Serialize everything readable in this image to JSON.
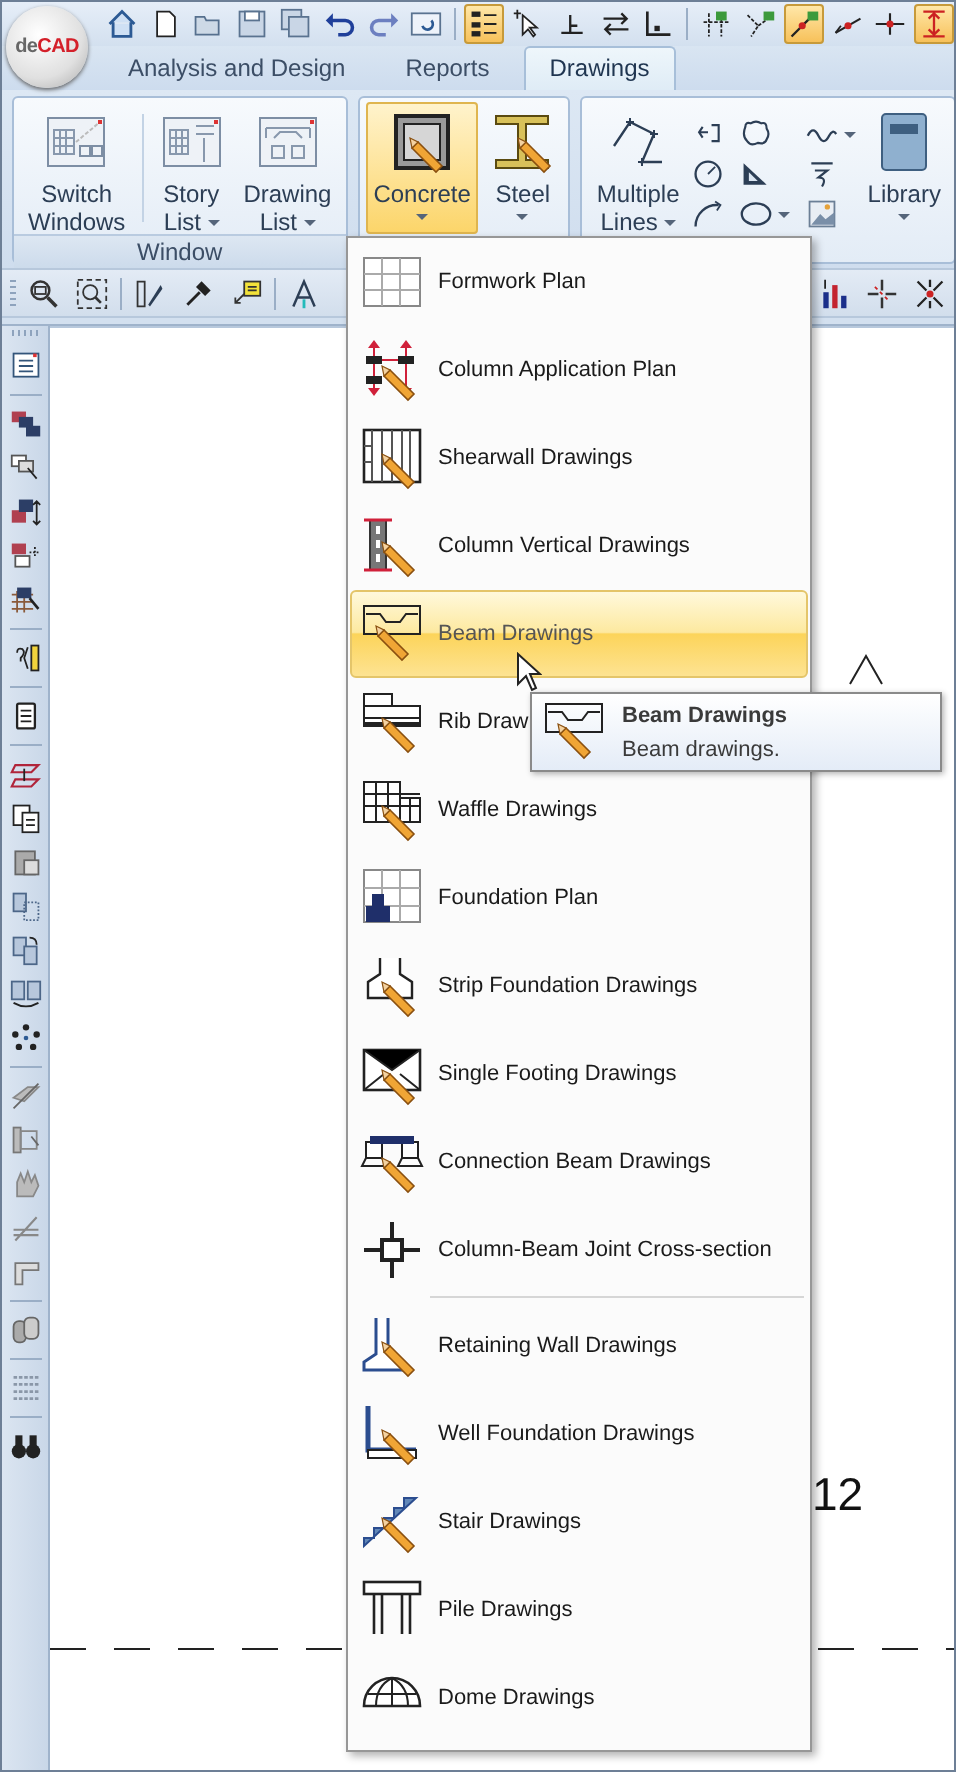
{
  "app": {
    "logo_prefix": "de",
    "logo_name": "CAD"
  },
  "quick_access_toolbar": [
    {
      "on": false
    },
    {
      "on": false
    },
    {
      "on": false
    },
    {
      "on": false
    },
    {
      "on": false
    },
    {
      "on": false
    },
    {
      "on": false
    },
    {
      "on": false
    },
    {
      "on": true
    },
    {
      "on": false
    },
    {
      "on": false
    },
    {
      "on": false
    },
    {
      "on": false
    },
    {
      "on": false
    },
    {
      "on": false
    },
    {
      "on": true
    },
    {
      "on": false
    },
    {
      "on": false
    },
    {
      "on": true
    }
  ],
  "tabs": [
    {
      "label": "Analysis and Design",
      "selected": false
    },
    {
      "label": "Reports",
      "selected": false
    },
    {
      "label": "Drawings",
      "selected": true
    }
  ],
  "ribbon": {
    "groups": [
      {
        "label": "Window",
        "buttons": [
          {
            "label": "Switch Windows",
            "dropdown": false,
            "selected": false
          },
          {
            "label": "Story List",
            "dropdown": true,
            "selected": false
          },
          {
            "label": "Drawing List",
            "dropdown": true,
            "selected": false
          }
        ]
      },
      {
        "buttons": [
          {
            "label": "Concrete",
            "dropdown": true,
            "selected": true
          },
          {
            "label": "Steel",
            "dropdown": true,
            "selected": false
          }
        ]
      },
      {
        "buttons": [
          {
            "label": "Multiple Lines",
            "dropdown": true,
            "selected": false
          },
          {
            "label": "Library",
            "dropdown": true,
            "selected": false
          }
        ]
      }
    ]
  },
  "canvas": {
    "label": "12"
  },
  "dropdown_menu": {
    "items": [
      {
        "label": "Formwork Plan",
        "selected": false,
        "separator_before": false
      },
      {
        "label": "Column Application Plan",
        "selected": false,
        "separator_before": false
      },
      {
        "label": "Shearwall Drawings",
        "selected": false,
        "separator_before": false
      },
      {
        "label": "Column Vertical Drawings",
        "selected": false,
        "separator_before": false
      },
      {
        "label": "Beam Drawings",
        "selected": true,
        "separator_before": false
      },
      {
        "label": "Rib Draw",
        "selected": false,
        "separator_before": false
      },
      {
        "label": "Waffle Drawings",
        "selected": false,
        "separator_before": false
      },
      {
        "label": "Foundation Plan",
        "selected": false,
        "separator_before": false
      },
      {
        "label": "Strip Foundation Drawings",
        "selected": false,
        "separator_before": false
      },
      {
        "label": "Single Footing Drawings",
        "selected": false,
        "separator_before": false
      },
      {
        "label": "Connection Beam Drawings",
        "selected": false,
        "separator_before": false
      },
      {
        "label": "Column-Beam Joint Cross-section",
        "selected": false,
        "separator_before": false
      },
      {
        "label": "Retaining Wall Drawings",
        "selected": false,
        "separator_before": true
      },
      {
        "label": "Well Foundation Drawings",
        "selected": false,
        "separator_before": false
      },
      {
        "label": "Stair Drawings",
        "selected": false,
        "separator_before": false
      },
      {
        "label": "Pile Drawings",
        "selected": false,
        "separator_before": false
      },
      {
        "label": "Dome Drawings",
        "selected": false,
        "separator_before": false
      }
    ]
  },
  "tooltip": {
    "title": "Beam Drawings",
    "description": "Beam drawings."
  }
}
